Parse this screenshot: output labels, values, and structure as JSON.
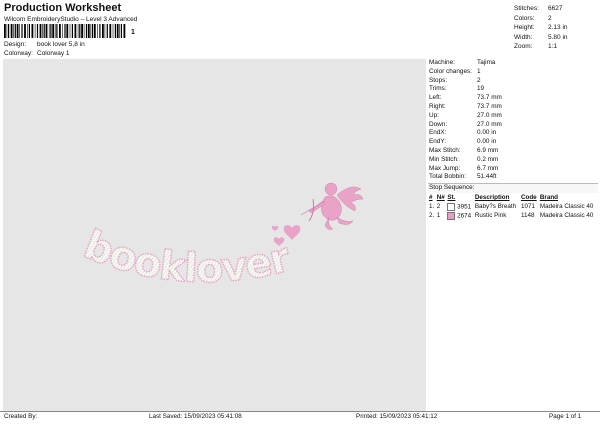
{
  "header": {
    "title": "Production Worksheet",
    "subtitle": "Wilcom EmbroideryStudio – Level 3 Advanced",
    "barcode_number": "1"
  },
  "meta": [
    {
      "label": "Design:",
      "value": "book lover 5,8 in"
    },
    {
      "label": "Colorway:",
      "value": "Colorway 1"
    }
  ],
  "summary": [
    {
      "label": "Stitches:",
      "value": "6627"
    },
    {
      "label": "Colors:",
      "value": "2"
    },
    {
      "label": "Height:",
      "value": "2.13 in"
    },
    {
      "label": "Width:",
      "value": "5.80 in"
    },
    {
      "label": "Zoom:",
      "value": "1:1"
    }
  ],
  "machine_info": [
    {
      "label": "Machine:",
      "value": "Tajima"
    },
    {
      "label": "Color changes:",
      "value": "1"
    },
    {
      "label": "Stops:",
      "value": "2"
    },
    {
      "label": "Trims:",
      "value": "19"
    },
    {
      "label": "Left:",
      "value": "73.7 mm"
    },
    {
      "label": "Right:",
      "value": "73.7 mm"
    },
    {
      "label": "Up:",
      "value": "27.0 mm"
    },
    {
      "label": "Down:",
      "value": "27.0 mm"
    },
    {
      "label": "EndX:",
      "value": "0.00 in"
    },
    {
      "label": "EndY:",
      "value": "0.00 in"
    },
    {
      "label": "Max Stitch:",
      "value": "6.9 mm"
    },
    {
      "label": "Min Stitch:",
      "value": "0.2 mm"
    },
    {
      "label": "Max Jump:",
      "value": "6.7 mm"
    },
    {
      "label": "Total Bobbin:",
      "value": "51.44ft"
    }
  ],
  "stop_sequence": {
    "title": "Stop Sequence:",
    "headers": [
      "#",
      "N#",
      "St.",
      "Description",
      "Code",
      "Brand"
    ],
    "rows": [
      {
        "num": "1.",
        "n": "2",
        "st": "3951",
        "desc": "Baby?s Breath",
        "code": "1071",
        "brand": "Madeira Classic 40",
        "color": "#ffffff"
      },
      {
        "num": "2.",
        "n": "1",
        "st": "2674",
        "desc": "Rustic Pink",
        "code": "1148",
        "brand": "Madeira Classic 40",
        "color": "#e59bc3"
      }
    ]
  },
  "design_text": "booklover",
  "colors": {
    "canvas": "#e6e6e6",
    "thread_white": "#f3f6f1",
    "thread_pink": "#e8a3c7"
  },
  "footer": {
    "created_by": "Created By:",
    "last_saved": "Last Saved: 15/09/2023 05:41:08",
    "printed": "Printed: 15/09/2023 05:41:12",
    "page": "Page 1 of 1"
  }
}
